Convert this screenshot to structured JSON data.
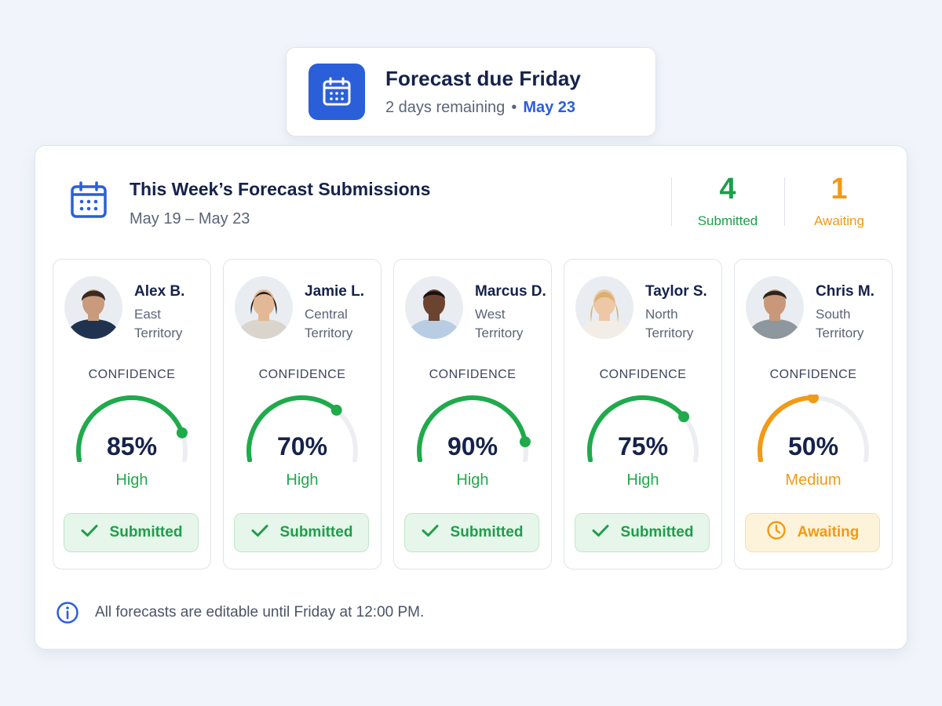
{
  "due_banner": {
    "title": "Forecast due Friday",
    "remaining": "2 days remaining",
    "separator": "•",
    "date": "May 23",
    "icon": "calendar-icon",
    "accent": "#2b5fd9"
  },
  "header": {
    "icon": "calendar-icon",
    "title": "This Week’s Forecast Submissions",
    "range": "May 19 – May 23"
  },
  "summary": {
    "submitted": {
      "count": "4",
      "label": "Submitted",
      "color": "#1e9e4a"
    },
    "awaiting": {
      "count": "1",
      "label": "Awaiting",
      "color": "#f29a14"
    }
  },
  "reps": [
    {
      "name": "Alex B.",
      "territory_line1": "East",
      "territory_line2": "Territory",
      "confidence_label": "CONFIDENCE",
      "confidence": 85,
      "confidence_text": "85%",
      "level": "High",
      "status": "submitted",
      "status_label": "Submitted",
      "status_icon": "check-icon",
      "color": "#1faa4b"
    },
    {
      "name": "Jamie L.",
      "territory_line1": "Central",
      "territory_line2": "Territory",
      "confidence_label": "CONFIDENCE",
      "confidence": 70,
      "confidence_text": "70%",
      "level": "High",
      "status": "submitted",
      "status_label": "Submitted",
      "status_icon": "check-icon",
      "color": "#1faa4b"
    },
    {
      "name": "Marcus D.",
      "territory_line1": "West",
      "territory_line2": "Territory",
      "confidence_label": "CONFIDENCE",
      "confidence": 90,
      "confidence_text": "90%",
      "level": "High",
      "status": "submitted",
      "status_label": "Submitted",
      "status_icon": "check-icon",
      "color": "#1faa4b"
    },
    {
      "name": "Taylor S.",
      "territory_line1": "North",
      "territory_line2": "Territory",
      "confidence_label": "CONFIDENCE",
      "confidence": 75,
      "confidence_text": "75%",
      "level": "High",
      "status": "submitted",
      "status_label": "Submitted",
      "status_icon": "check-icon",
      "color": "#1faa4b"
    },
    {
      "name": "Chris M.",
      "territory_line1": "South",
      "territory_line2": "Territory",
      "confidence_label": "CONFIDENCE",
      "confidence": 50,
      "confidence_text": "50%",
      "level": "Medium",
      "status": "awaiting",
      "status_label": "Awaiting",
      "status_icon": "clock-icon",
      "color": "#f29a14"
    }
  ],
  "footer": {
    "icon": "info-icon",
    "text": "All forecasts are editable until Friday at 12:00 PM."
  }
}
